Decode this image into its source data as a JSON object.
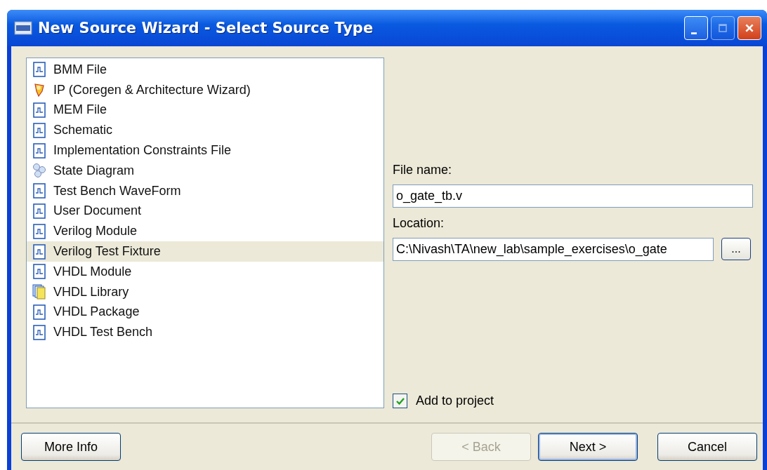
{
  "window": {
    "title": "New Source Wizard - Select Source Type",
    "maximize_disabled": true
  },
  "source_types": [
    {
      "label": "BMM File",
      "kind": "doc",
      "selected": false
    },
    {
      "label": "IP (Coregen & Architecture Wizard)",
      "kind": "bulb",
      "selected": false
    },
    {
      "label": "MEM File",
      "kind": "doc",
      "selected": false
    },
    {
      "label": "Schematic",
      "kind": "doc",
      "selected": false
    },
    {
      "label": "Implementation Constraints File",
      "kind": "doc",
      "selected": false
    },
    {
      "label": "State Diagram",
      "kind": "bubbles",
      "selected": false
    },
    {
      "label": "Test Bench WaveForm",
      "kind": "doc",
      "selected": false
    },
    {
      "label": "User Document",
      "kind": "doc",
      "selected": false
    },
    {
      "label": "Verilog Module",
      "kind": "doc",
      "selected": false
    },
    {
      "label": "Verilog Test Fixture",
      "kind": "doc",
      "selected": true
    },
    {
      "label": "VHDL Module",
      "kind": "doc",
      "selected": false
    },
    {
      "label": "VHDL Library",
      "kind": "stack",
      "selected": false
    },
    {
      "label": "VHDL Package",
      "kind": "doc",
      "selected": false
    },
    {
      "label": "VHDL Test Bench",
      "kind": "doc",
      "selected": false
    }
  ],
  "file_name": {
    "label": "File name:",
    "value": "o_gate_tb.v"
  },
  "location": {
    "label": "Location:",
    "value": "C:\\Nivash\\TA\\new_lab\\sample_exercises\\o_gate",
    "browse": "..."
  },
  "add_to_project": {
    "label": "Add to project",
    "checked": true
  },
  "buttons": [
    {
      "label": "More Info",
      "disabled": false,
      "default": false
    },
    {
      "label": "< Back",
      "disabled": true,
      "default": false
    },
    {
      "label": "Next >",
      "disabled": false,
      "default": true
    },
    {
      "label": "Cancel",
      "disabled": false,
      "default": false
    }
  ]
}
